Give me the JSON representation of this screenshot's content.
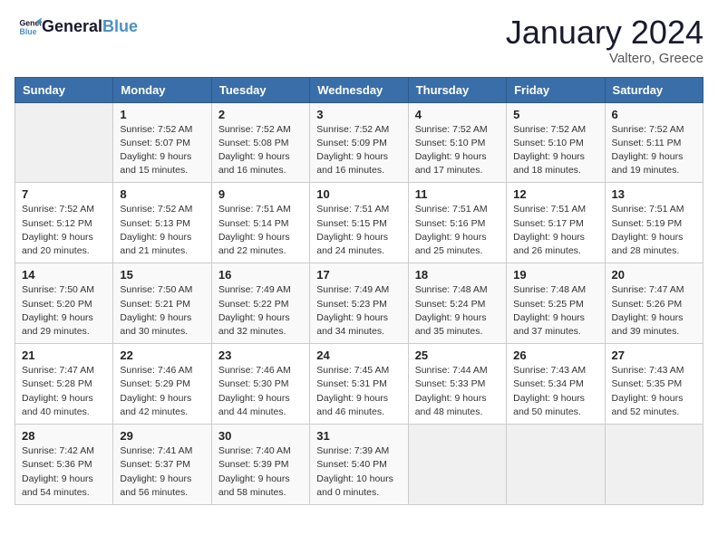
{
  "header": {
    "logo_line1": "General",
    "logo_line2": "Blue",
    "month": "January 2024",
    "location": "Valtero, Greece"
  },
  "days_of_week": [
    "Sunday",
    "Monday",
    "Tuesday",
    "Wednesday",
    "Thursday",
    "Friday",
    "Saturday"
  ],
  "weeks": [
    [
      {
        "day": "",
        "sunrise": "",
        "sunset": "",
        "daylight": ""
      },
      {
        "day": "1",
        "sunrise": "7:52 AM",
        "sunset": "5:07 PM",
        "daylight": "9 hours and 15 minutes."
      },
      {
        "day": "2",
        "sunrise": "7:52 AM",
        "sunset": "5:08 PM",
        "daylight": "9 hours and 16 minutes."
      },
      {
        "day": "3",
        "sunrise": "7:52 AM",
        "sunset": "5:09 PM",
        "daylight": "9 hours and 16 minutes."
      },
      {
        "day": "4",
        "sunrise": "7:52 AM",
        "sunset": "5:10 PM",
        "daylight": "9 hours and 17 minutes."
      },
      {
        "day": "5",
        "sunrise": "7:52 AM",
        "sunset": "5:10 PM",
        "daylight": "9 hours and 18 minutes."
      },
      {
        "day": "6",
        "sunrise": "7:52 AM",
        "sunset": "5:11 PM",
        "daylight": "9 hours and 19 minutes."
      }
    ],
    [
      {
        "day": "7",
        "sunrise": "7:52 AM",
        "sunset": "5:12 PM",
        "daylight": "9 hours and 20 minutes."
      },
      {
        "day": "8",
        "sunrise": "7:52 AM",
        "sunset": "5:13 PM",
        "daylight": "9 hours and 21 minutes."
      },
      {
        "day": "9",
        "sunrise": "7:51 AM",
        "sunset": "5:14 PM",
        "daylight": "9 hours and 22 minutes."
      },
      {
        "day": "10",
        "sunrise": "7:51 AM",
        "sunset": "5:15 PM",
        "daylight": "9 hours and 24 minutes."
      },
      {
        "day": "11",
        "sunrise": "7:51 AM",
        "sunset": "5:16 PM",
        "daylight": "9 hours and 25 minutes."
      },
      {
        "day": "12",
        "sunrise": "7:51 AM",
        "sunset": "5:17 PM",
        "daylight": "9 hours and 26 minutes."
      },
      {
        "day": "13",
        "sunrise": "7:51 AM",
        "sunset": "5:19 PM",
        "daylight": "9 hours and 28 minutes."
      }
    ],
    [
      {
        "day": "14",
        "sunrise": "7:50 AM",
        "sunset": "5:20 PM",
        "daylight": "9 hours and 29 minutes."
      },
      {
        "day": "15",
        "sunrise": "7:50 AM",
        "sunset": "5:21 PM",
        "daylight": "9 hours and 30 minutes."
      },
      {
        "day": "16",
        "sunrise": "7:49 AM",
        "sunset": "5:22 PM",
        "daylight": "9 hours and 32 minutes."
      },
      {
        "day": "17",
        "sunrise": "7:49 AM",
        "sunset": "5:23 PM",
        "daylight": "9 hours and 34 minutes."
      },
      {
        "day": "18",
        "sunrise": "7:48 AM",
        "sunset": "5:24 PM",
        "daylight": "9 hours and 35 minutes."
      },
      {
        "day": "19",
        "sunrise": "7:48 AM",
        "sunset": "5:25 PM",
        "daylight": "9 hours and 37 minutes."
      },
      {
        "day": "20",
        "sunrise": "7:47 AM",
        "sunset": "5:26 PM",
        "daylight": "9 hours and 39 minutes."
      }
    ],
    [
      {
        "day": "21",
        "sunrise": "7:47 AM",
        "sunset": "5:28 PM",
        "daylight": "9 hours and 40 minutes."
      },
      {
        "day": "22",
        "sunrise": "7:46 AM",
        "sunset": "5:29 PM",
        "daylight": "9 hours and 42 minutes."
      },
      {
        "day": "23",
        "sunrise": "7:46 AM",
        "sunset": "5:30 PM",
        "daylight": "9 hours and 44 minutes."
      },
      {
        "day": "24",
        "sunrise": "7:45 AM",
        "sunset": "5:31 PM",
        "daylight": "9 hours and 46 minutes."
      },
      {
        "day": "25",
        "sunrise": "7:44 AM",
        "sunset": "5:33 PM",
        "daylight": "9 hours and 48 minutes."
      },
      {
        "day": "26",
        "sunrise": "7:43 AM",
        "sunset": "5:34 PM",
        "daylight": "9 hours and 50 minutes."
      },
      {
        "day": "27",
        "sunrise": "7:43 AM",
        "sunset": "5:35 PM",
        "daylight": "9 hours and 52 minutes."
      }
    ],
    [
      {
        "day": "28",
        "sunrise": "7:42 AM",
        "sunset": "5:36 PM",
        "daylight": "9 hours and 54 minutes."
      },
      {
        "day": "29",
        "sunrise": "7:41 AM",
        "sunset": "5:37 PM",
        "daylight": "9 hours and 56 minutes."
      },
      {
        "day": "30",
        "sunrise": "7:40 AM",
        "sunset": "5:39 PM",
        "daylight": "9 hours and 58 minutes."
      },
      {
        "day": "31",
        "sunrise": "7:39 AM",
        "sunset": "5:40 PM",
        "daylight": "10 hours and 0 minutes."
      },
      {
        "day": "",
        "sunrise": "",
        "sunset": "",
        "daylight": ""
      },
      {
        "day": "",
        "sunrise": "",
        "sunset": "",
        "daylight": ""
      },
      {
        "day": "",
        "sunrise": "",
        "sunset": "",
        "daylight": ""
      }
    ]
  ],
  "labels": {
    "sunrise": "Sunrise:",
    "sunset": "Sunset:",
    "daylight": "Daylight:"
  }
}
